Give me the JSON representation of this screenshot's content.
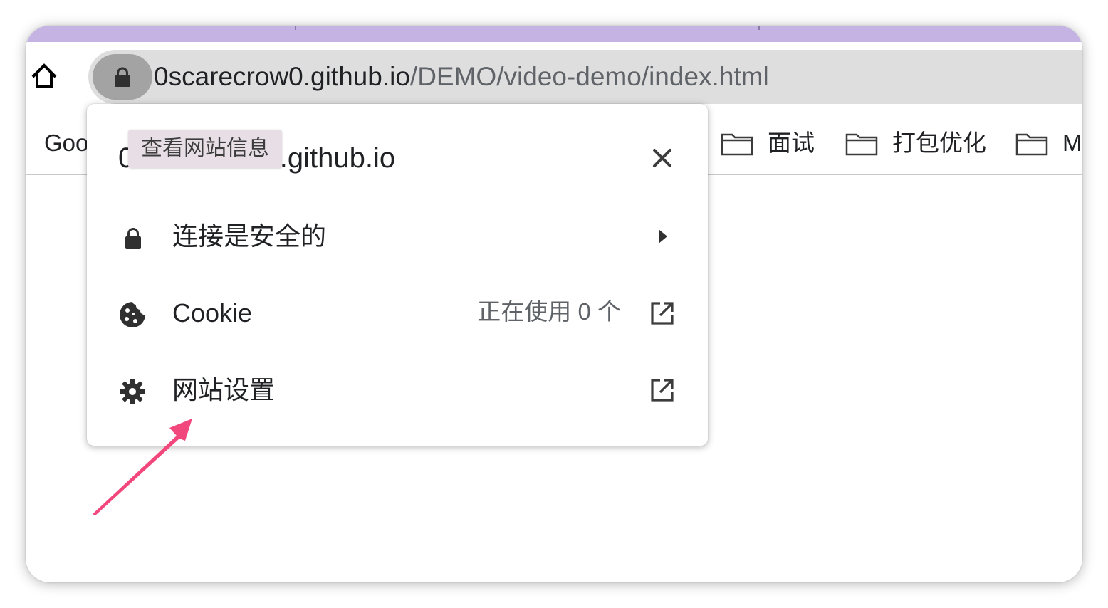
{
  "browser": {
    "accent_color": "#c5b3e3",
    "home_icon": "home-icon",
    "address_bar": {
      "host": "0scarecrow0.github.io",
      "path": "/DEMO/video-demo/index.html",
      "security_icon": "lock-icon"
    },
    "bookmarks": [
      {
        "label": "Goo",
        "icon": ""
      },
      {
        "label": "面试",
        "icon": "folder-icon"
      },
      {
        "label": "打包优化",
        "icon": "folder-icon"
      },
      {
        "label": "M",
        "icon": "folder-icon"
      }
    ]
  },
  "site_info_popup": {
    "title": "0scarecrow0.github.io",
    "tooltip": "查看网站信息",
    "close_icon": "close-icon",
    "rows": [
      {
        "icon": "lock-icon",
        "label": "连接是安全的",
        "trailing_icon": "chevron-right-icon"
      },
      {
        "icon": "cookie-icon",
        "label": "Cookie",
        "status": "正在使用 0 个",
        "trailing_icon": "external-link-icon"
      },
      {
        "icon": "gear-icon",
        "label": "网站设置",
        "trailing_icon": "external-link-icon"
      }
    ]
  },
  "annotation": {
    "color": "#f2477c",
    "icon": "pointer-arrow"
  }
}
